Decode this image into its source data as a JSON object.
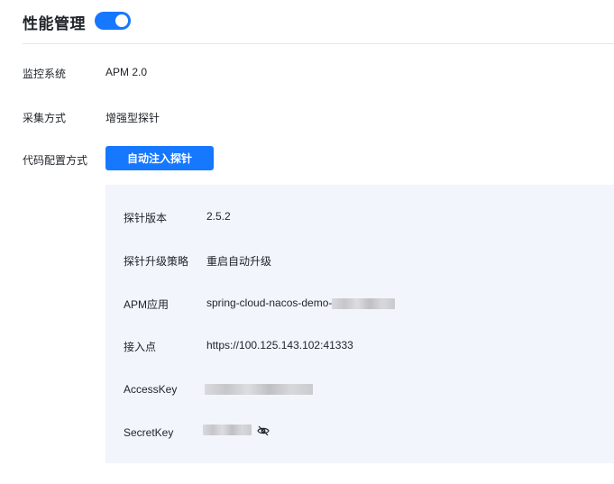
{
  "header": {
    "title": "性能管理",
    "toggle_on": true,
    "accent_color": "#1677ff"
  },
  "rows": [
    {
      "label": "监控系统",
      "value": "APM 2.0"
    },
    {
      "label": "采集方式",
      "value": "增强型探针"
    },
    {
      "label": "代码配置方式",
      "button": "自动注入探针"
    }
  ],
  "panel": {
    "items": [
      {
        "label": "探针版本",
        "value": "2.5.2"
      },
      {
        "label": "探针升级策略",
        "value": "重启自动升级"
      },
      {
        "label": "APM应用",
        "value": "spring-cloud-nacos-demo-"
      },
      {
        "label": "接入点",
        "value": "https://100.125.143.102:41333"
      },
      {
        "label": "AccessKey",
        "value": ""
      },
      {
        "label": "SecretKey",
        "value": "",
        "icon": "eye-off-icon"
      }
    ]
  }
}
